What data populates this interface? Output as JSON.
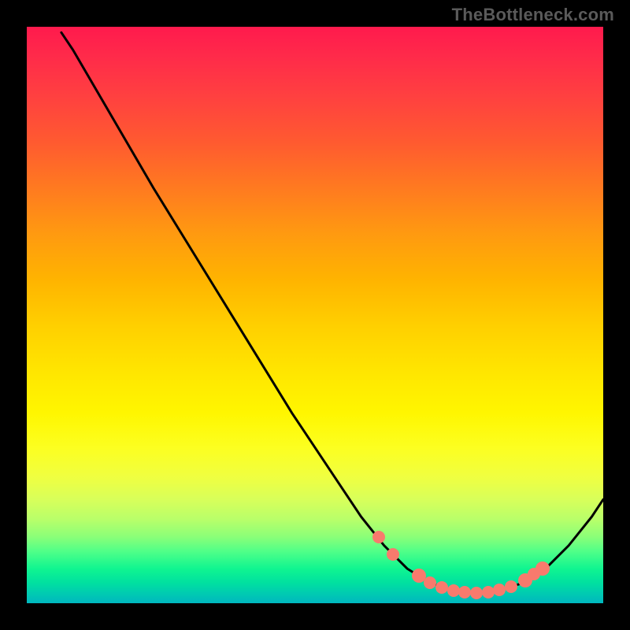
{
  "attribution": "TheBottleneck.com",
  "chart_data": {
    "type": "line",
    "title": "",
    "xlabel": "",
    "ylabel": "",
    "xlim": [
      0,
      100
    ],
    "ylim": [
      0,
      100
    ],
    "curve": [
      {
        "x": 6,
        "y": 99
      },
      {
        "x": 8,
        "y": 96
      },
      {
        "x": 15,
        "y": 84
      },
      {
        "x": 22,
        "y": 72
      },
      {
        "x": 30,
        "y": 59
      },
      {
        "x": 38,
        "y": 46
      },
      {
        "x": 46,
        "y": 33
      },
      {
        "x": 54,
        "y": 21
      },
      {
        "x": 58,
        "y": 15
      },
      {
        "x": 62,
        "y": 10
      },
      {
        "x": 66,
        "y": 6
      },
      {
        "x": 70,
        "y": 3.5
      },
      {
        "x": 74,
        "y": 2.2
      },
      {
        "x": 78,
        "y": 1.8
      },
      {
        "x": 82,
        "y": 2.2
      },
      {
        "x": 86,
        "y": 3.5
      },
      {
        "x": 90,
        "y": 6
      },
      {
        "x": 94,
        "y": 10
      },
      {
        "x": 98,
        "y": 15
      },
      {
        "x": 100,
        "y": 18
      }
    ],
    "markers": [
      {
        "x": 61,
        "y": 11.5,
        "size": "normal"
      },
      {
        "x": 63.5,
        "y": 8.5,
        "size": "normal"
      },
      {
        "x": 68,
        "y": 4.8,
        "size": "big"
      },
      {
        "x": 70,
        "y": 3.5,
        "size": "normal"
      },
      {
        "x": 72,
        "y": 2.7,
        "size": "normal"
      },
      {
        "x": 74,
        "y": 2.2,
        "size": "normal"
      },
      {
        "x": 76,
        "y": 1.9,
        "size": "normal"
      },
      {
        "x": 78,
        "y": 1.8,
        "size": "normal"
      },
      {
        "x": 80,
        "y": 1.9,
        "size": "normal"
      },
      {
        "x": 82,
        "y": 2.3,
        "size": "normal"
      },
      {
        "x": 84,
        "y": 2.9,
        "size": "normal"
      },
      {
        "x": 86.5,
        "y": 4.0,
        "size": "big"
      },
      {
        "x": 88,
        "y": 5.0,
        "size": "normal"
      },
      {
        "x": 89.5,
        "y": 6.0,
        "size": "big"
      }
    ],
    "background": "rainbow-gradient"
  }
}
